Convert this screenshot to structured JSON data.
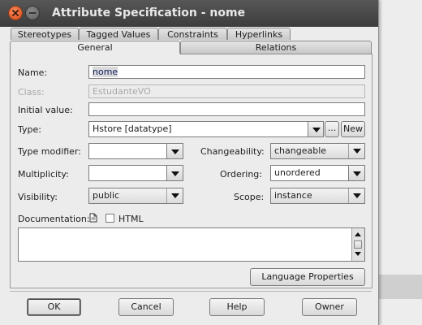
{
  "window": {
    "title": "Attribute Specification - nome"
  },
  "tabs_row1": [
    "Stereotypes",
    "Tagged Values",
    "Constraints",
    "Hyperlinks"
  ],
  "tabs_row2": {
    "general": "General",
    "relations": "Relations"
  },
  "form": {
    "name_label": "Name:",
    "name_value": "nome",
    "class_label": "Class:",
    "class_value": "EstudanteVO",
    "initial_value_label": "Initial value:",
    "initial_value": "",
    "type_label": "Type:",
    "type_value": "Hstore [datatype]",
    "browse_label": "...",
    "new_label": "New",
    "type_modifier_label": "Type modifier:",
    "type_modifier_value": "",
    "changeability_label": "Changeability:",
    "changeability_value": "changeable",
    "multiplicity_label": "Multiplicity:",
    "multiplicity_value": "",
    "ordering_label": "Ordering:",
    "ordering_value": "unordered",
    "visibility_label": "Visibility:",
    "visibility_value": "public",
    "scope_label": "Scope:",
    "scope_value": "instance",
    "documentation_label": "Documentation:",
    "html_label": "HTML",
    "html_checked": false,
    "language_properties_label": "Language Properties"
  },
  "buttons": {
    "ok": "OK",
    "cancel": "Cancel",
    "help": "Help",
    "owner": "Owner"
  },
  "colors": {
    "titlebar": "#3c3c3c",
    "close_button": "#dd4814",
    "name_selection": "#dadada"
  },
  "icons": [
    "close-icon",
    "minimize-icon",
    "document-icon",
    "dropdown-arrow-icon",
    "scroll-up-icon",
    "scroll-down-icon"
  ]
}
